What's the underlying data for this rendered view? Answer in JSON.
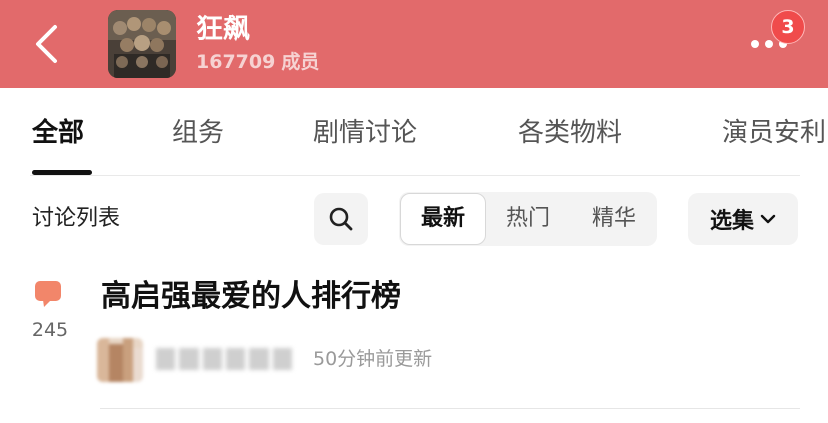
{
  "header": {
    "group_name": "狂飙",
    "member_count": "167709",
    "member_suffix": "成员",
    "notification_badge": "3",
    "colors": {
      "background": "#e26a6b",
      "badge": "#f04b4b"
    }
  },
  "tabs": [
    {
      "label": "全部",
      "active": true
    },
    {
      "label": "组务",
      "active": false
    },
    {
      "label": "剧情讨论",
      "active": false
    },
    {
      "label": "各类物料",
      "active": false
    },
    {
      "label": "演员安利",
      "active": false
    }
  ],
  "filter": {
    "list_title": "讨论列表",
    "search_icon": "search-icon",
    "sort_options": [
      {
        "label": "最新",
        "selected": true
      },
      {
        "label": "热门",
        "selected": false
      },
      {
        "label": "精华",
        "selected": false
      }
    ],
    "episode_label": "选集",
    "episode_icon": "chevron-down-icon"
  },
  "posts": [
    {
      "comment_count": "245",
      "title": "高启强最爱的人排行榜",
      "update_time": "50分钟前更新",
      "comment_icon_color": "#f2866a"
    }
  ]
}
